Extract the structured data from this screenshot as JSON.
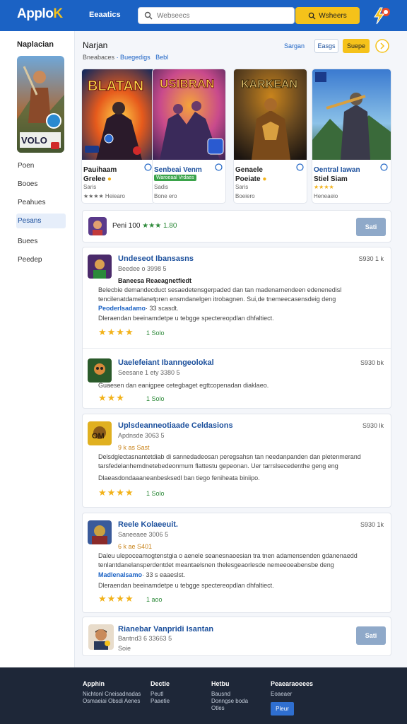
{
  "header": {
    "logo_main": "Applo",
    "logo_accent": "K",
    "nav_label": "Eeaatics",
    "search_placeholder": "Webseecs",
    "search_button": "Wsheers",
    "colors": {
      "primary": "#1b62c4",
      "accent": "#f5c21a"
    }
  },
  "sidebar": {
    "title": "Naplacian",
    "items": [
      "Poen",
      "Booes",
      "Peahues",
      "Pesans",
      "Buees",
      "Peedep"
    ],
    "active_index": 3
  },
  "section": {
    "title": "Narjan",
    "subtitle_a": "Bneabaces",
    "subtitle_b": "· Buegedigs",
    "subtitle_c": "Bebl",
    "link": "Sargan",
    "btn1": "Easgs",
    "btn2": "Suepe"
  },
  "cards": [
    {
      "name_line1": "Pauihaam",
      "name_line2": "Grelee",
      "meta": "Saris",
      "rating": "★★★★ Heiearo",
      "art_title": "BLATAN",
      "palette": [
        "#8a2d10",
        "#e65a1c",
        "#1a2a5a"
      ]
    },
    {
      "name_line1": "Senbeai Venm",
      "name_line2": "",
      "meta": "Sadis",
      "rating": "Bone ero",
      "badge": "Waroeaal Vrdaes",
      "art_title": "USIBRAN",
      "palette": [
        "#2e1e4e",
        "#c94a8c",
        "#f5a43a"
      ]
    },
    {
      "name_line1": "Genaele",
      "name_line2": "Poeiate",
      "meta": "Saris",
      "rating": "Boeiero",
      "art_title": "KARKEAN",
      "palette": [
        "#1a1410",
        "#6a4a20",
        "#c9841c"
      ]
    },
    {
      "name_line1": "Oentral Iawan",
      "name_line2": "Stiel Siam",
      "meta": "★★★★",
      "rating": "Heneaeio",
      "art_title": "",
      "palette": [
        "#3a7ad0",
        "#8cc2e8",
        "#2a5a2a"
      ]
    }
  ],
  "highlight": {
    "name": "Peni 100",
    "stars": "★★★",
    "score": "1.80",
    "button": "Sati"
  },
  "reviews": [
    {
      "name": "Undeseot Ibansasns",
      "date": "S930 1 k",
      "meta": "Beedee o 3998 5",
      "title": "Baneesa Reaeagnetfiedt",
      "body_line1": "Belecbie demandecduct sesaedetensgerpaded dan tan madenarnendeen edenenedisl",
      "body_line2": "tencilenatdamelanetpren ensmdanelgen itrobagnen. Sui,de tnemeecasensdeig deng",
      "link": "Peoderlsadamo",
      "link_meta": "· 33 scasdt.",
      "body_line3": "Dleraendan beeinamdetpe u tebgge spectereopdlan dhfaltiect.",
      "stars": "★★★★",
      "votes": "1 Solo"
    },
    {
      "name": "Uaelefeiant Ibanngeolokal",
      "date": "S930 bk",
      "meta": "Seesane 1 ety 3380 5",
      "title": "",
      "body_line1": "",
      "body_line2": "",
      "link": "",
      "link_meta": "",
      "body_line3": "Guaesen dan eanigpee cetegbaget egttcopenadan diaklaeo.",
      "stars": "★★★",
      "votes": "1 Solo"
    },
    {
      "name": "Uplsdeanneotiaade Celdasions",
      "date": "S930 lk",
      "meta": "Apdnsde 3063 5",
      "title": "9 k as Sast",
      "body_line1": "Delsdglectasnantetdiab di sannedadeosan peregsahsn tan needanpanden dan pletenmerand",
      "body_line2": "tarsfedelanhemdnetebedeonmum flattestu gepeonan. Uer tarrslsecedenthe geng eng",
      "link": "",
      "link_meta": "",
      "body_line3": "Dlaeasdondaaaneanbesksedl ban tiego feniheata biniipo.",
      "stars": "★★★★",
      "votes": "1 Solo"
    },
    {
      "name": "Reele Kolaeeuit.",
      "date": "S930 1k",
      "meta": "Saneeaee 3006 5",
      "title": "6 k ae S401",
      "body_line1": "Daleu ulepoceamogtenstgia o aenele seanesnaoesian tra tnen adamensenden gdanenaedd",
      "body_line2": "tenlantdanelansperdentdet meantaelsnen thelesgeaorlesde nemeeoeabensbe deng",
      "link": "Madlenalsamo",
      "link_meta": "· 33 s eaaeslst.",
      "body_line3": "Dleraendan beeinamdetpe u tebgge spectereopdlan dhfaltiect.",
      "stars": "★★★★",
      "votes": "1 aoo"
    }
  ],
  "bottom_item": {
    "name": "Rianebar Vanpridi Isantan",
    "meta": "Bantnd3 6 33663 5",
    "sub": "Soie",
    "button": "Sati"
  },
  "footer": {
    "col1_title": "Apphin",
    "col1_lines": [
      "Nichtonl Cneisadnadas",
      "Osmaeiai Obsdi Aenes"
    ],
    "col2_title": "Dectie",
    "col2_lines": [
      "Peutl",
      "Paaetie"
    ],
    "col3_title": "Hetbu",
    "col3_lines": [
      "Bausnd",
      "Donngse boda",
      "Otles"
    ],
    "col4_title": "Peaearaoeees",
    "col4_lines": [
      "Eoaeaer"
    ],
    "button": "Pleur"
  }
}
